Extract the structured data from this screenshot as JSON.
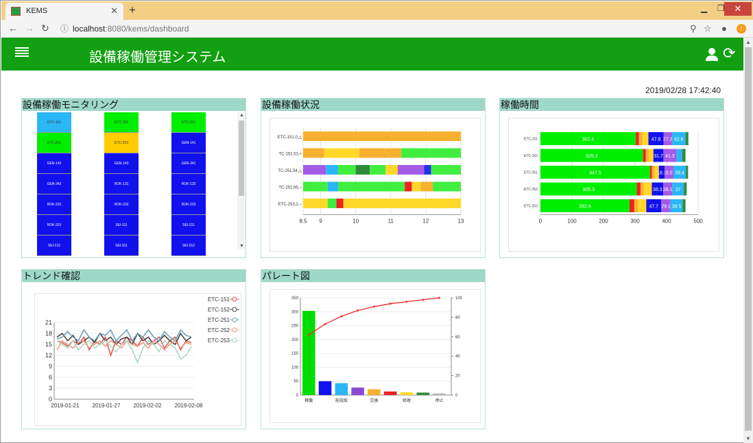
{
  "browser": {
    "tab_title": "KEMS",
    "url_host": "localhost",
    "url_path": ":8080/kems/dashboard"
  },
  "app": {
    "title": "設備稼働管理システム",
    "timestamp": "2019/02/28 17:42:40"
  },
  "colors": {
    "header_green": "#12a012",
    "panel_header": "#9ed8c8",
    "running_green": "#00ff00",
    "idle_blue": "#1111ee",
    "cyan": "#2ab7f5",
    "yellow": "#ffcc00"
  },
  "panels": {
    "monitor": {
      "title": "設備稼働モニタリング",
      "tiles": [
        {
          "label": "ETC-151",
          "color": "#2ab7f5"
        },
        {
          "label": "ETC-152",
          "color": "#00ee00"
        },
        {
          "label": "ETC-251",
          "color": "#00ee00"
        },
        {
          "label": "ETC-252",
          "color": "#00ee00"
        },
        {
          "label": "ETC-253",
          "color": "#ffcc00"
        },
        {
          "label": "GEN-141",
          "color": "#1111ee"
        },
        {
          "label": "GEN-142",
          "color": "#1111ee"
        },
        {
          "label": "GEN-143",
          "color": "#1111ee"
        },
        {
          "label": "GEN-341",
          "color": "#1111ee"
        },
        {
          "label": "GEN-342",
          "color": "#1111ee"
        },
        {
          "label": "ROK-131",
          "color": "#1111ee"
        },
        {
          "label": "ROK-132",
          "color": "#1111ee"
        },
        {
          "label": "ROK-231",
          "color": "#1111ee"
        },
        {
          "label": "ROK-232",
          "color": "#1111ee"
        },
        {
          "label": "ROK-233",
          "color": "#1111ee"
        },
        {
          "label": "ROK-331",
          "color": "#1111ee"
        },
        {
          "label": "SEI-111",
          "color": "#1111ee"
        },
        {
          "label": "SEI-211",
          "color": "#1111ee"
        },
        {
          "label": "SEI-212",
          "color": "#1111ee"
        },
        {
          "label": "SEI-311",
          "color": "#1111ee"
        },
        {
          "label": "SEI-312",
          "color": "#1111ee"
        }
      ]
    },
    "status": {
      "title": "設備稼働状況"
    },
    "hours": {
      "title": "稼働時間"
    },
    "trend": {
      "title": "トレンド確認"
    },
    "pareto": {
      "title": "パレート図"
    }
  },
  "chart_data": [
    {
      "type": "bar",
      "name": "status_timeline",
      "orientation": "horizontal",
      "categories": [
        "ETC-151,0,△",
        "TC-152,53,×",
        "TC-251,54,△",
        "TC-252,95,○",
        "ETC-253,2,○"
      ],
      "xlim": [
        8.5,
        13
      ],
      "xticks": [
        "8.5",
        "9",
        "10",
        "11",
        "12",
        "13"
      ],
      "segments": [
        [
          {
            "start": 8.5,
            "end": 13,
            "color": "#f7b12f"
          }
        ],
        [
          {
            "start": 8.5,
            "end": 9.1,
            "color": "#f7b12f"
          },
          {
            "start": 9.1,
            "end": 10.1,
            "color": "#ffd82a"
          },
          {
            "start": 10.1,
            "end": 11.3,
            "color": "#f7b12f"
          },
          {
            "start": 11.3,
            "end": 13,
            "color": "#40ee40"
          }
        ],
        [
          {
            "start": 8.5,
            "end": 9.15,
            "color": "#a55be8"
          },
          {
            "start": 9.15,
            "end": 9.5,
            "color": "#2ab7f5"
          },
          {
            "start": 9.5,
            "end": 10.0,
            "color": "#40ee40"
          },
          {
            "start": 10.0,
            "end": 10.4,
            "color": "#2e8b3a"
          },
          {
            "start": 10.4,
            "end": 10.85,
            "color": "#40ee40"
          },
          {
            "start": 10.85,
            "end": 11.2,
            "color": "#ffd82a"
          },
          {
            "start": 11.2,
            "end": 11.95,
            "color": "#a55be8"
          },
          {
            "start": 11.95,
            "end": 12.15,
            "color": "#2233ee"
          },
          {
            "start": 12.15,
            "end": 13,
            "color": "#40ee40"
          }
        ],
        [
          {
            "start": 8.5,
            "end": 9.2,
            "color": "#40ee40"
          },
          {
            "start": 9.2,
            "end": 9.5,
            "color": "#2ab7f5"
          },
          {
            "start": 9.5,
            "end": 11.4,
            "color": "#40ee40"
          },
          {
            "start": 11.4,
            "end": 11.6,
            "color": "#ee2222"
          },
          {
            "start": 11.6,
            "end": 11.85,
            "color": "#ffd82a"
          },
          {
            "start": 11.85,
            "end": 12.2,
            "color": "#f7b12f"
          },
          {
            "start": 12.2,
            "end": 13,
            "color": "#40ee40"
          }
        ],
        [
          {
            "start": 8.5,
            "end": 9.2,
            "color": "#ffd82a"
          },
          {
            "start": 9.2,
            "end": 9.45,
            "color": "#40ee40"
          },
          {
            "start": 9.45,
            "end": 9.65,
            "color": "#ee2222"
          },
          {
            "start": 9.65,
            "end": 13,
            "color": "#ffd82a"
          }
        ]
      ]
    },
    {
      "type": "bar",
      "name": "operating_hours",
      "orientation": "horizontal",
      "stacked": true,
      "categories": [
        "ETC-151",
        "ETC-152",
        "ETC-251",
        "ETC-252",
        "ETC-253"
      ],
      "xlim": [
        0,
        500
      ],
      "xticks": [
        "0",
        "100",
        "200",
        "300",
        "400",
        "500"
      ],
      "series_colors": [
        "#00ee00",
        "#ee2222",
        "#f7b12f",
        "#ffd82a",
        "#1111ee",
        "#a55be8",
        "#2ab7f5",
        "#2e8b3a"
      ],
      "rows": [
        {
          "values": [
            302.4,
            10,
            12,
            18,
            47.8,
            27.2,
            42.6,
            9
          ],
          "labels": [
            "302.4",
            "",
            "",
            "",
            "47.8",
            "27.2",
            "42.6",
            ""
          ]
        },
        {
          "values": [
            325.3,
            9,
            10,
            14,
            31.7,
            41.3,
            18,
            10.6
          ],
          "labels": [
            "325.3",
            "",
            "",
            "",
            "31.7",
            "41.3",
            "",
            ""
          ]
        },
        {
          "values": [
            347.5,
            6,
            9,
            13,
            18.2,
            28,
            39.4,
            7
          ],
          "labels": [
            "347.5",
            "",
            "",
            "",
            "18.2",
            "8.0",
            "39.4",
            ""
          ]
        },
        {
          "values": [
            305.3,
            12,
            10,
            26,
            36.3,
            28.1,
            37,
            9
          ],
          "labels": [
            "305.3",
            "",
            "",
            "",
            "36.3",
            "28.1",
            "37",
            ""
          ]
        },
        {
          "values": [
            282.6,
            15,
            12,
            26,
            47.7,
            29.1,
            38.5,
            9
          ],
          "labels": [
            "282.6",
            "",
            "",
            "",
            "47.7",
            "29.1",
            "38.5",
            ""
          ]
        }
      ]
    },
    {
      "type": "line",
      "name": "trend",
      "x": [
        "2019-01-21",
        "2019-01-27",
        "2019-02-02",
        "2019-02-08"
      ],
      "ylim": [
        0,
        21
      ],
      "yticks": [
        "0",
        "3",
        "6",
        "9",
        "12",
        "15",
        "18",
        "21"
      ],
      "series": [
        {
          "name": "ETC-151",
          "color": "#e05555",
          "values": [
            16,
            15.5,
            14.5,
            16,
            15,
            17,
            13.5,
            16,
            15,
            17,
            12,
            16,
            15,
            17,
            16,
            14.5,
            17,
            15,
            16,
            17,
            14,
            16,
            17,
            13.5,
            16,
            15.5
          ]
        },
        {
          "name": "ETC-152",
          "color": "#444444",
          "values": [
            17,
            18,
            16,
            17.5,
            15,
            16,
            17,
            15.5,
            18,
            16,
            17,
            15,
            16.5,
            17,
            15,
            18,
            16,
            17,
            15,
            16,
            17.5,
            16,
            15,
            18,
            16,
            17
          ]
        },
        {
          "name": "ETC-251",
          "color": "#6fa0b8",
          "values": [
            16.5,
            17,
            18.5,
            17,
            16,
            19,
            17,
            16,
            18,
            17.5,
            19,
            16,
            17.5,
            19,
            16,
            18,
            17,
            19,
            17,
            16,
            18.5,
            17,
            16,
            19,
            17.5,
            17
          ]
        },
        {
          "name": "ETC-252",
          "color": "#ee9a80",
          "values": [
            13.5,
            16,
            15,
            14,
            15.5,
            16,
            14,
            15,
            16,
            14.5,
            16,
            15,
            14,
            16,
            15,
            14.5,
            15.5,
            14,
            16,
            15,
            13.5,
            15,
            16,
            14,
            15.5,
            15
          ]
        },
        {
          "name": "ETC-253",
          "color": "#a8d8c0",
          "values": [
            16,
            15,
            14,
            16,
            13.5,
            15,
            16,
            14,
            15,
            16,
            14.5,
            13,
            15,
            16,
            13.5,
            10,
            14,
            16,
            15,
            13,
            16,
            15,
            14,
            11,
            12,
            14.5
          ]
        }
      ]
    },
    {
      "type": "bar",
      "name": "pareto",
      "categories": [
        "稼働",
        "",
        "前段取",
        "",
        "交換",
        "",
        "修理",
        "",
        "停止"
      ],
      "values": [
        303,
        50,
        43,
        27,
        21,
        13,
        10,
        9,
        6
      ],
      "colors": [
        "#00dd00",
        "#1111ee",
        "#2ab7f5",
        "#8a4ad8",
        "#f7b12f",
        "#ee2222",
        "#ffd82a",
        "#2e8b3a",
        "#bbbbbb"
      ],
      "cumulative": [
        62,
        73,
        81,
        87,
        91,
        94,
        96,
        98,
        100
      ],
      "ylim": [
        0,
        350
      ],
      "yticks": [
        "0",
        "50",
        "100",
        "150",
        "200",
        "250",
        "300",
        "350"
      ],
      "y2lim": [
        0,
        100
      ],
      "y2ticks": [
        "0",
        "20",
        "40",
        "60",
        "80",
        "100"
      ]
    }
  ]
}
